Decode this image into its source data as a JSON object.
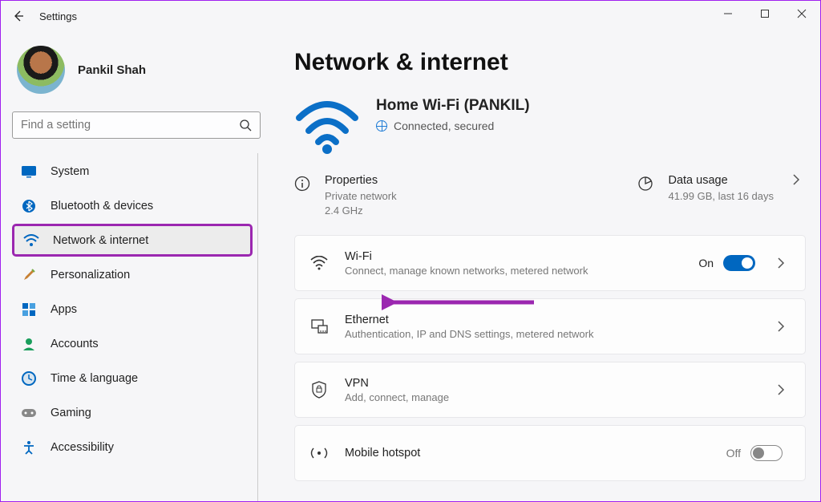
{
  "window": {
    "title": "Settings"
  },
  "profile": {
    "name": "Pankil Shah"
  },
  "search": {
    "placeholder": "Find a setting"
  },
  "sidebar": {
    "items": [
      {
        "label": "System"
      },
      {
        "label": "Bluetooth & devices"
      },
      {
        "label": "Network & internet"
      },
      {
        "label": "Personalization"
      },
      {
        "label": "Apps"
      },
      {
        "label": "Accounts"
      },
      {
        "label": "Time & language"
      },
      {
        "label": "Gaming"
      },
      {
        "label": "Accessibility"
      }
    ]
  },
  "main": {
    "heading": "Network & internet",
    "network": {
      "name": "Home Wi-Fi (PANKIL)",
      "status": "Connected, secured"
    },
    "props": {
      "properties_label": "Properties",
      "properties_sub": "Private network\n2.4 GHz",
      "datausage_label": "Data usage",
      "datausage_sub": "41.99 GB, last 16 days"
    },
    "cards": {
      "wifi": {
        "label": "Wi-Fi",
        "sub": "Connect, manage known networks, metered network",
        "state": "On"
      },
      "ethernet": {
        "label": "Ethernet",
        "sub": "Authentication, IP and DNS settings, metered network"
      },
      "vpn": {
        "label": "VPN",
        "sub": "Add, connect, manage"
      },
      "hotspot": {
        "label": "Mobile hotspot",
        "state": "Off"
      }
    }
  }
}
